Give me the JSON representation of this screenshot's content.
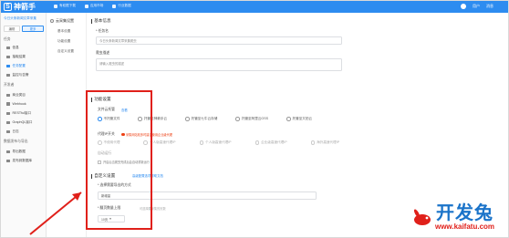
{
  "app": {
    "logo_text": "神箭手"
  },
  "topnav": [
    {
      "label": "有权限下载"
    },
    {
      "label": "应用市场"
    },
    {
      "label": "行业数据"
    }
  ],
  "topright": {
    "user": "用户",
    "msg": "消息"
  },
  "sidebar": {
    "crumb": "今日头条新闻文章采集",
    "btn_edit": "编辑",
    "btn_other": "更多",
    "groups": [
      {
        "label": "任务"
      },
      {
        "label": "开发者"
      },
      {
        "label": "数据发布与导出"
      }
    ],
    "items": [
      {
        "label": "信息"
      },
      {
        "label": "抽取结果"
      },
      {
        "label": "任务配置"
      },
      {
        "label": "监控与告警"
      },
      {
        "label": "商业类目"
      },
      {
        "label": "Webhook"
      },
      {
        "label": "RESTful接口"
      },
      {
        "label": "GraphQL接口"
      },
      {
        "label": "日志"
      },
      {
        "label": "导出数据"
      },
      {
        "label": "发布到数据库"
      }
    ]
  },
  "subnav": {
    "head": "云采集设置",
    "items": [
      {
        "label": "基本设置"
      },
      {
        "label": "功能设置"
      },
      {
        "label": "自定义设置"
      }
    ]
  },
  "basic": {
    "title": "基本信息",
    "name_label": "* 任务名",
    "name_value": "今日头条新闻文章采集爬虫",
    "desc_label": "爬虫描述",
    "desc_placeholder": "请输入爬虫的描述"
  },
  "func": {
    "title": "功能设置",
    "file_cloud_label": "文件云托管",
    "file_cloud_link": "查看",
    "storage_options": [
      {
        "label": "不托管文件",
        "on": true
      },
      {
        "label": "托管至神箭手云",
        "on": false
      },
      {
        "label": "托管至七牛云存储",
        "on": false
      },
      {
        "label": "托管至阿里云OSS",
        "on": false
      },
      {
        "label": "托管至又拍云",
        "on": false
      }
    ],
    "proxy_label": "代理IP开关",
    "proxy_warn": "采集网站较多时建议使用企业级代理",
    "proxy_options": [
      {
        "label": "不使用代理"
      },
      {
        "label": "个人版高速代理IP"
      },
      {
        "label": "个人版高速代理IP"
      },
      {
        "label": "企业级高速代理IP"
      },
      {
        "label": "海外高速代理IP"
      }
    ],
    "auto_label": "自动运行",
    "auto_check": "开启后当爬虫完成后会自动重新运行"
  },
  "custom": {
    "title": "自定义设置",
    "link": "高级配置选项帮助文档",
    "field1_label": "* 选择需要导出的方式",
    "field1_value": "新增量",
    "field2_label": "* 翻页数量上限",
    "field2_hint": "可选择要采集的页数",
    "field2_value": "10页"
  },
  "watermark": {
    "cn": "开发兔",
    "en": "www.kaifatu.com"
  },
  "colors": {
    "brand": "#2d8cf0",
    "highlight": "#e0201a",
    "watermark_blue": "#1a73c9"
  }
}
